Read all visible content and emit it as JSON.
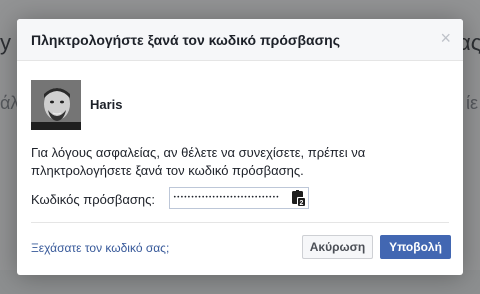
{
  "background": {
    "left_fragment_1": "y",
    "left_fragment_2": "άλ",
    "right_fragment_1": "ας",
    "right_fragment_2": "ίε"
  },
  "dialog": {
    "title": "Πληκτρολογήστε ξανά τον κωδικό πρόσβασης",
    "close_icon": "×",
    "user_name": "Haris",
    "message": "Για λόγους ασφαλείας, αν θέλετε να συνεχίσετε, πρέπει να πληκτρολογήσετε ξανά τον κωδικό πρόσβασης.",
    "password_label": "Κωδικός πρόσβασης:",
    "password_value": "••••••••••••••••••••••••••••••",
    "password_manager_badge": "2",
    "forgot_link": "Ξεχάσατε τον κωδικό σας;",
    "cancel_label": "Ακύρωση",
    "submit_label": "Υποβολή"
  },
  "colors": {
    "accent": "#4267b2",
    "link": "#365899",
    "overlay": "rgba(0,0,0,0.40)"
  }
}
